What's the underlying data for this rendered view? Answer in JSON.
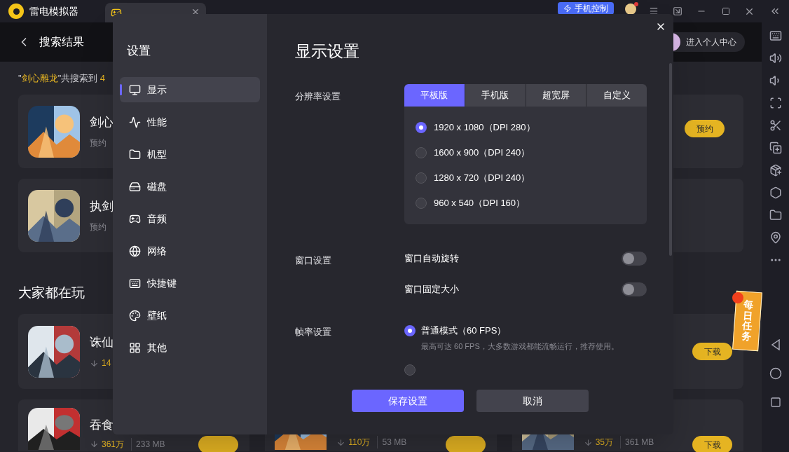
{
  "app": {
    "title": "雷电模拟器",
    "phone_control": "手机控制"
  },
  "header": {
    "title": "搜索结果",
    "profile": "进入个人中心"
  },
  "search_summary": {
    "before": "\"",
    "keyword": "剑心雕龙",
    "after": "\"共搜索到 ",
    "count": "4"
  },
  "search_results": [
    {
      "title": "剑心",
      "subtitle": "预约",
      "button": "预约"
    },
    {
      "title": "执剑",
      "subtitle": "预约"
    }
  ],
  "popular": {
    "title": "大家都在玩",
    "cards": [
      {
        "kind": "game",
        "title": "诛仙",
        "downloads": "14"
      },
      {
        "kind": "covered"
      },
      {
        "kind": "button_only",
        "button": "下载"
      },
      {
        "kind": "game",
        "title": "吞食",
        "downloads": "361万",
        "size": "233 MB",
        "download_button": true
      },
      {
        "kind": "game",
        "downloads": "110万",
        "size": "53 MB",
        "download_button": true
      },
      {
        "kind": "game",
        "downloads": "35万",
        "size": "361 MB",
        "button": "下载"
      }
    ]
  },
  "daily_task": "每日任务",
  "settings": {
    "title": "设置",
    "nav": [
      {
        "label": "显示",
        "selected": true
      },
      {
        "label": "性能",
        "selected": false
      },
      {
        "label": "机型",
        "selected": false
      },
      {
        "label": "磁盘",
        "selected": false
      },
      {
        "label": "音频",
        "selected": false
      },
      {
        "label": "网络",
        "selected": false
      },
      {
        "label": "快捷键",
        "selected": false
      },
      {
        "label": "壁纸",
        "selected": false
      },
      {
        "label": "其他",
        "selected": false
      }
    ],
    "page_title": "显示设置",
    "resolution": {
      "label": "分辨率设置",
      "tabs": [
        {
          "label": "平板版",
          "selected": true
        },
        {
          "label": "手机版",
          "selected": false
        },
        {
          "label": "超宽屏",
          "selected": false
        },
        {
          "label": "自定义",
          "selected": false
        }
      ],
      "options": [
        {
          "label": "1920 x 1080（DPI 280）",
          "selected": true
        },
        {
          "label": "1600 x 900（DPI 240）",
          "selected": false
        },
        {
          "label": "1280 x 720（DPI 240）",
          "selected": false
        },
        {
          "label": "960 x 540（DPI 160）",
          "selected": false
        }
      ]
    },
    "window": {
      "label": "窗口设置",
      "toggles": [
        {
          "label": "窗口自动旋转",
          "on": false
        },
        {
          "label": "窗口固定大小",
          "on": false
        }
      ]
    },
    "framerate": {
      "label": "帧率设置",
      "options": [
        {
          "label": "普通模式（60 FPS）",
          "description": "最高可达 60 FPS，大多数游戏都能流畅运行，推荐使用。",
          "selected": true
        },
        {
          "selected": false
        }
      ]
    },
    "save": "保存设置",
    "cancel": "取消"
  }
}
